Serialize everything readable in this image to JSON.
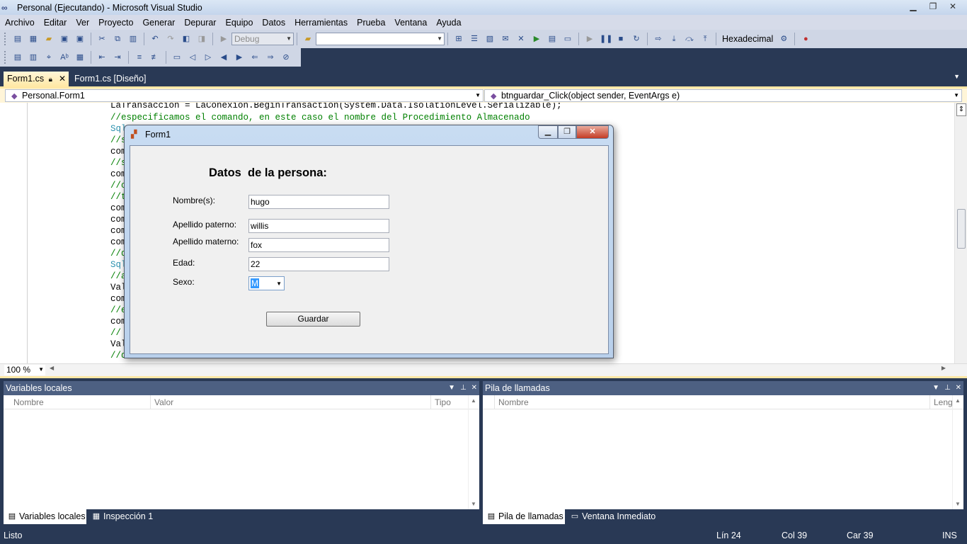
{
  "window": {
    "title": "Personal (Ejecutando) - Microsoft Visual Studio",
    "app_icon": "visual-studio-infinity-icon",
    "controls": [
      "minimize-icon",
      "maximize-icon",
      "close-icon"
    ]
  },
  "menu": [
    "Archivo",
    "Editar",
    "Ver",
    "Proyecto",
    "Generar",
    "Depurar",
    "Equipo",
    "Datos",
    "Herramientas",
    "Prueba",
    "Ventana",
    "Ayuda"
  ],
  "toolbar": {
    "config_combo": "Debug",
    "platform_combo": "",
    "hex_label": "Hexadecimal"
  },
  "tabs": {
    "active": "Form1.cs",
    "inactive": "Form1.cs [Diseño]"
  },
  "nav": {
    "class_combo": "Personal.Form1",
    "member_combo": "btnguardar_Click(object sender, EventArgs e)"
  },
  "code": {
    "line0": "LaTransaccion = LaConexion.BeginTransaction(System.Data.IsolationLevel.Serializable);",
    "line1": "//especificamos el comando, en este caso el nombre del Procedimiento Almacenado",
    "stubs": [
      {
        "text": "Sql",
        "kind": "type"
      },
      {
        "text": "//s",
        "kind": "comment"
      },
      {
        "text": "com",
        "kind": "normal"
      },
      {
        "text": "//s",
        "kind": "comment"
      },
      {
        "text": "com",
        "kind": "normal"
      },
      {
        "text": "//c",
        "kind": "comment"
      },
      {
        "text": "//t",
        "kind": "comment"
      },
      {
        "text": "com",
        "kind": "normal"
      },
      {
        "text": "com",
        "kind": "normal"
      },
      {
        "text": "com",
        "kind": "normal"
      },
      {
        "text": "com",
        "kind": "normal"
      },
      {
        "text": "//d",
        "kind": "comment"
      },
      {
        "text": "Sql",
        "kind": "type"
      },
      {
        "text": "//a",
        "kind": "comment"
      },
      {
        "text": "Val",
        "kind": "normal"
      },
      {
        "text": "com",
        "kind": "normal"
      },
      {
        "text": "//e",
        "kind": "comment"
      },
      {
        "text": "com",
        "kind": "normal"
      },
      {
        "text": "// ",
        "kind": "comment"
      },
      {
        "text": "Val",
        "kind": "normal"
      },
      {
        "text": "//d",
        "kind": "comment"
      }
    ],
    "zoom": "100 %"
  },
  "form1": {
    "title": "Form1",
    "heading": "Datos  de la persona:",
    "fields": [
      {
        "label": "Nombre(s):",
        "value": "hugo"
      },
      {
        "label": "Apellido paterno:",
        "value": "willis"
      },
      {
        "label": "Apellido materno:",
        "value": "fox"
      },
      {
        "label": "Edad:",
        "value": "22"
      }
    ],
    "sexo_label": "Sexo:",
    "sexo_value": "M",
    "button": "Guardar"
  },
  "panels": {
    "left": {
      "title": "Variables locales",
      "columns": [
        "Nombre",
        "Valor",
        "Tipo"
      ],
      "tabs": [
        "Variables locales",
        "Inspección 1"
      ]
    },
    "right": {
      "title": "Pila de llamadas",
      "columns": [
        "Nombre",
        "Leng"
      ],
      "tabs": [
        "Pila de llamadas",
        "Ventana Inmediato"
      ]
    }
  },
  "status": {
    "text": "Listo",
    "line": "Lín 24",
    "col": "Col 39",
    "car": "Car 39",
    "mode": "INS"
  },
  "colors": {
    "ide_background": "#293955",
    "active_tab": "#ffe8a6",
    "comment": "#008000",
    "type": "#2b91af",
    "selection": "#3399ff"
  }
}
